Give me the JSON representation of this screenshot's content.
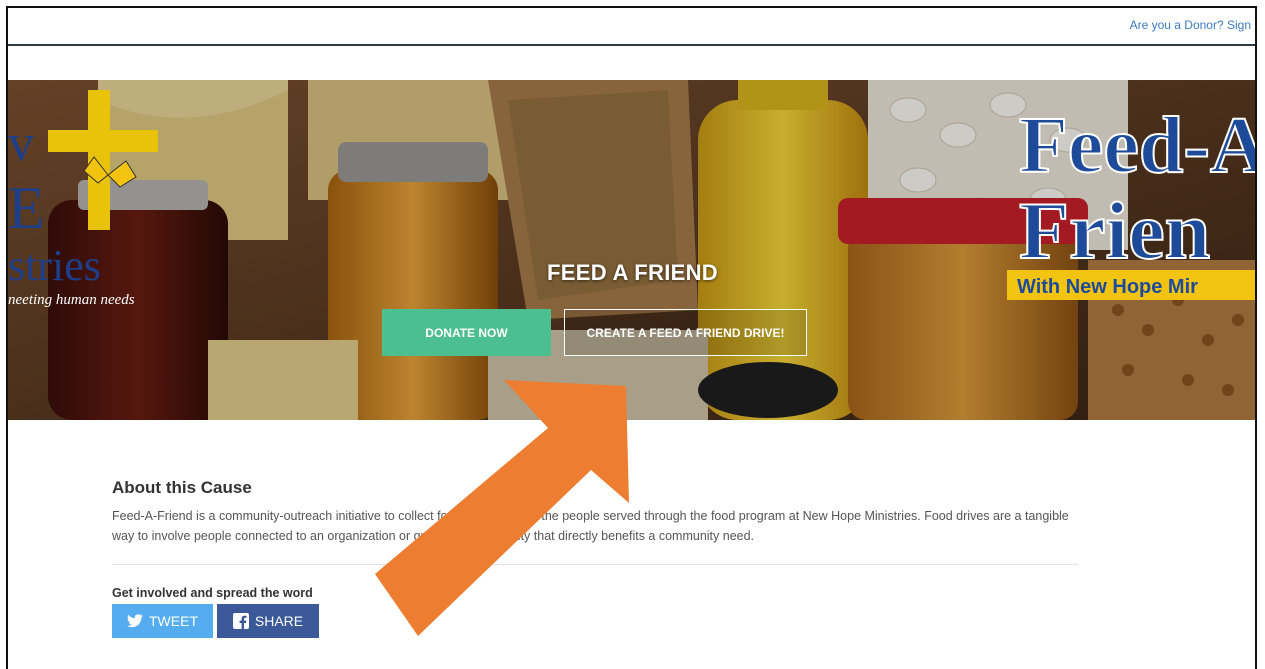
{
  "header": {
    "donor_link": "Are you a Donor? Sign"
  },
  "hero": {
    "title": "FEED A FRIEND",
    "donate_label": "DONATE NOW",
    "drive_label": "CREATE A FEED A FRIEND DRIVE!",
    "logo_left_lines": [
      "v",
      "E",
      "stries",
      "neeting human needs"
    ],
    "logo_right_lines": [
      "Feed-A",
      "Frien",
      "With New Hope Mir"
    ]
  },
  "about": {
    "heading": "About this Cause",
    "text": "Feed-A-Friend is a community-outreach initiative to collect food and funds for the people served through the food program at New Hope Ministries. Food drives are a tangible way to involve people connected to an organization or group with an activity that directly benefits a community need."
  },
  "share": {
    "heading": "Get involved and spread the word",
    "tweet_label": "TWEET",
    "share_label": "SHARE"
  },
  "colors": {
    "accent_green": "#4bbf8f",
    "twitter_blue": "#55acee",
    "facebook_blue": "#3b5998",
    "arrow_orange": "#ed7d31"
  },
  "icons": {
    "tweet": "twitter-bird-icon",
    "share": "facebook-icon",
    "annotation": "arrow-icon"
  }
}
